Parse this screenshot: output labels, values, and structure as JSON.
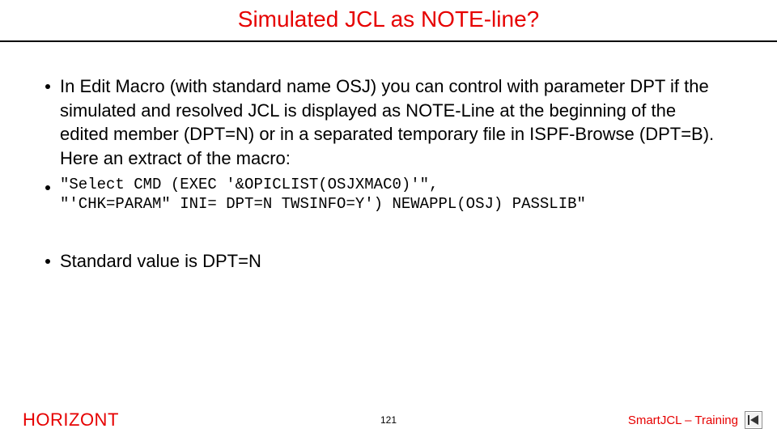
{
  "title": "Simulated JCL as NOTE-line?",
  "bullets": {
    "b1": "In Edit Macro (with standard name OSJ) you can control with parameter DPT if the simulated and resolved JCL is displayed as NOTE-Line at the beginning of the edited member (DPT=N) or in a separated temporary file in ISPF-Browse (DPT=B). Here an extract of the macro:",
    "b2": "\"Select CMD (EXEC '&OPICLIST(OSJXMAC0)'\",\n\"'CHK=PARAM\" INI= DPT=N TWSINFO=Y') NEWAPPL(OSJ) PASSLIB\"",
    "b3": "Standard value is DPT=N"
  },
  "footer": {
    "left": "HORIZONT",
    "page": "121",
    "right": "SmartJCL – Training"
  },
  "icons": {
    "back": "skip-back-icon"
  }
}
